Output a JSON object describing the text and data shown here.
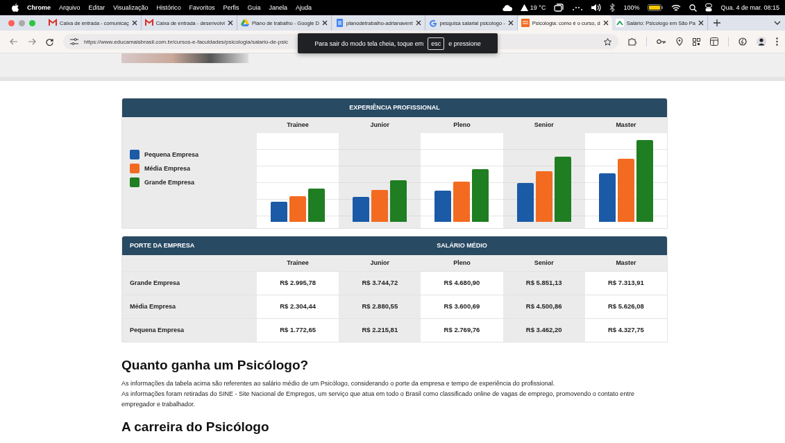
{
  "menu_bar": {
    "app": "Chrome",
    "items": [
      "Arquivo",
      "Editar",
      "Visualização",
      "Histórico",
      "Favoritos",
      "Perfis",
      "Guia",
      "Janela",
      "Ajuda"
    ],
    "weather": "19 °C",
    "battery": "100%",
    "clock": "Qua. 4 de mar.  08:15"
  },
  "tabs": [
    {
      "title": "Caixa de entrada - comunicaç",
      "kind": "mail",
      "selected": false
    },
    {
      "title": "Caixa de entrada - desenvolvi",
      "kind": "mail",
      "selected": false
    },
    {
      "title": "Plano de trabalho - Google D",
      "kind": "drive",
      "selected": false
    },
    {
      "title": "planodetrabalho-adrianavent",
      "kind": "doc",
      "selected": false
    },
    {
      "title": "pesquisa salarial psicologo -",
      "kind": "search",
      "selected": false
    },
    {
      "title": "Psicologia: como é o curso, d",
      "kind": "site",
      "selected": true
    },
    {
      "title": "Salário: Psicologo em São Pa",
      "kind": "green",
      "selected": false
    }
  ],
  "address_bar": {
    "url": "https://www.educamaisbrasil.com.br/cursos-e-faculdades/psicologia/salario-de-psic"
  },
  "fullscreen_notice": {
    "before": "Para sair do modo tela cheia, toque em",
    "key": "esc",
    "after": "e pressione"
  },
  "chart": {
    "title": "EXPERIÊNCIA PROFISSIONAL",
    "categories": [
      "Trainee",
      "Junior",
      "Pleno",
      "Senior",
      "Master"
    ],
    "legend": [
      {
        "label": "Pequena Empresa",
        "color": "#1a5aa6"
      },
      {
        "label": "Média Empresa",
        "color": "#f26b21"
      },
      {
        "label": "Grande Empresa",
        "color": "#1f7d22"
      }
    ]
  },
  "table": {
    "first_header": "PORTE DA EMPRESA",
    "group_header": "SALÁRIO MÉDIO",
    "columns": [
      "Trainee",
      "Junior",
      "Pleno",
      "Senior",
      "Master"
    ],
    "rows": [
      {
        "label": "Grande Empresa",
        "values": [
          "R$ 2.995,78",
          "R$ 3.744,72",
          "R$ 4.680,90",
          "R$ 5.851,13",
          "R$ 7.313,91"
        ]
      },
      {
        "label": "Média Empresa",
        "values": [
          "R$ 2.304,44",
          "R$ 2.880,55",
          "R$ 3.600,69",
          "R$ 4.500,86",
          "R$ 5.626,08"
        ]
      },
      {
        "label": "Pequena Empresa",
        "values": [
          "R$ 1.772,65",
          "R$ 2.215,81",
          "R$ 2.769,76",
          "R$ 3.462,20",
          "R$ 4.327,75"
        ]
      }
    ]
  },
  "article": {
    "heading": "Quanto ganha um Psicólogo?",
    "paragraphs": [
      "As informações da tabela acima são referentes ao salário médio de um Psicólogo, considerando o porte da empresa e tempo de experiência do profissional.",
      "As informações foram retiradas do SINE - Site Nacional de Empregos, um serviço que atua em todo o Brasil como classificado online de vagas de emprego, promovendo o contato entre empregador e trabalhador."
    ],
    "next_heading": "A carreira do Psicólogo"
  }
}
